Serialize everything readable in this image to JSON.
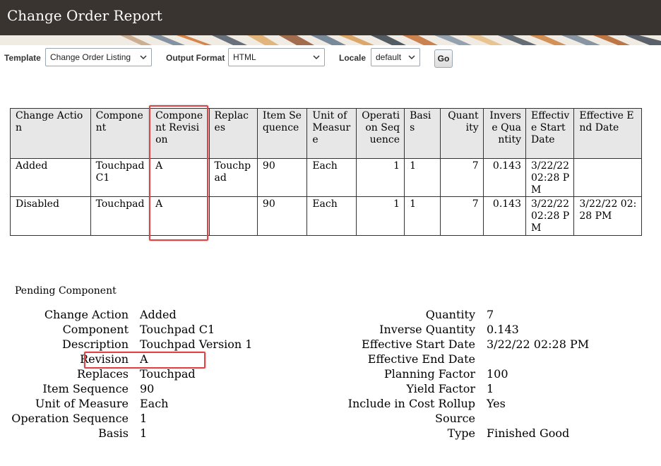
{
  "header": {
    "title": "Change Order Report"
  },
  "toolbar": {
    "template_label": "Template",
    "template_value": "Change Order Listing",
    "output_format_label": "Output Format",
    "output_format_value": "HTML",
    "locale_label": "Locale",
    "locale_value": "default",
    "go_label": "Go"
  },
  "table": {
    "columns": [
      "Change Action",
      "Component",
      "Component Revision",
      "Replaces",
      "Item Sequence",
      "Unit of Measure",
      "Operation Sequence",
      "Basis",
      "Quantity",
      "Inverse Quantity",
      "Effective Start Date",
      "Effective End Date"
    ],
    "rows": [
      [
        "Added",
        "Touchpad C1",
        "A",
        "Touchpad",
        "90",
        "Each",
        "1",
        "1",
        "7",
        "0.143",
        "3/22/22 02:28 PM",
        ""
      ],
      [
        "Disabled",
        "Touchpad",
        "A",
        "",
        "90",
        "Each",
        "1",
        "1",
        "7",
        "0.143",
        "3/22/22 02:28 PM",
        "3/22/22 02:28 PM"
      ]
    ]
  },
  "pending": {
    "section_title": "Pending Component",
    "left": [
      {
        "label": "Change Action",
        "value": "Added"
      },
      {
        "label": "Component",
        "value": "Touchpad C1"
      },
      {
        "label": "Description",
        "value": "Touchpad Version 1"
      },
      {
        "label": "Revision",
        "value": "A"
      },
      {
        "label": "Replaces",
        "value": "Touchpad"
      },
      {
        "label": "Item Sequence",
        "value": "90"
      },
      {
        "label": "Unit of Measure",
        "value": "Each"
      },
      {
        "label": "Operation Sequence",
        "value": "1"
      },
      {
        "label": "Basis",
        "value": "1"
      }
    ],
    "right": [
      {
        "label": "Quantity",
        "value": "7"
      },
      {
        "label": "Inverse Quantity",
        "value": "0.143"
      },
      {
        "label": "Effective Start Date",
        "value": "3/22/22 02:28 PM"
      },
      {
        "label": "Effective End Date",
        "value": ""
      },
      {
        "label": "Planning Factor",
        "value": "100"
      },
      {
        "label": "Yield Factor",
        "value": "1"
      },
      {
        "label": "Include in Cost Rollup",
        "value": "Yes"
      },
      {
        "label": "Source",
        "value": ""
      },
      {
        "label": "Type",
        "value": "Finished Good"
      }
    ]
  }
}
